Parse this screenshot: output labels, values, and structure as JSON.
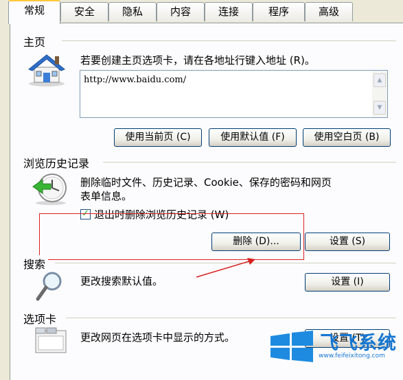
{
  "tabs": [
    {
      "label": "常规"
    },
    {
      "label": "安全"
    },
    {
      "label": "隐私"
    },
    {
      "label": "内容"
    },
    {
      "label": "连接"
    },
    {
      "label": "程序"
    },
    {
      "label": "高级"
    }
  ],
  "homepage": {
    "title": "主页",
    "instruction": "若要创建主页选项卡，请在各地址行键入地址 (R)。",
    "url_value": "http://www.baidu.com/",
    "buttons": {
      "use_current": "使用当前页 (C)",
      "use_default": "使用默认值 (F)",
      "use_blank": "使用空白页 (B)"
    }
  },
  "history": {
    "title": "浏览历史记录",
    "description_line1": "删除临时文件、历史记录、Cookie、保存的密码和网页",
    "description_line2": "表单信息。",
    "checkbox_label": "退出时删除浏览历史记录 (W)",
    "checkbox_checked": true,
    "delete_button": "删除 (D)...",
    "settings_button": "设置 (S)"
  },
  "search": {
    "title": "搜索",
    "description": "更改搜索默认值。",
    "settings_button": "设置 (I)"
  },
  "tabs_section": {
    "title": "选项卡",
    "description": "更改网页在选项卡中显示的方式。",
    "settings_button": "设置 (T)"
  },
  "watermark": {
    "title": "飞飞系统",
    "url": "www.feifeixitong.com"
  },
  "colors": {
    "annotation_red": "#d92020",
    "watermark_blue": "#1576d2",
    "dialog_background": "#ece9d8"
  }
}
